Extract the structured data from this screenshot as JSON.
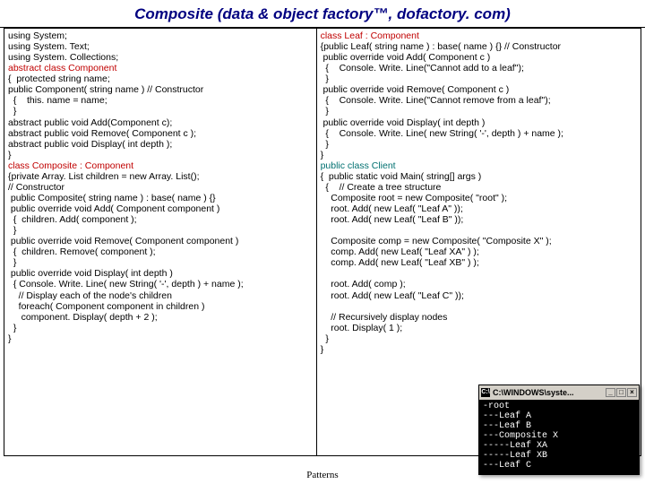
{
  "title": "Composite (data & object factory™, dofactory. com)",
  "left": {
    "l0": "using System;",
    "l1": "using System. Text;",
    "l2": "using System. Collections;",
    "l3": "abstract class Component",
    "l4": "{  protected string name;",
    "l5": "public Component( string name ) // Constructor",
    "l6": "  {    this. name = name;",
    "l7": "  }",
    "l8": "abstract public void Add(Component c);",
    "l9": "abstract public void Remove( Component c );",
    "l10": "abstract public void Display( int depth );",
    "l11": "}",
    "l12": "class Composite : Component",
    "l13": "{private Array. List children = new Array. List();",
    "l14": "// Constructor",
    "l15": " public Composite( string name ) : base( name ) {}",
    "l16": " public override void Add( Component component )",
    "l17": "  {  children. Add( component );",
    "l18": "  }",
    "l19": " public override void Remove( Component component )",
    "l20": "  {  children. Remove( component );",
    "l21": "  }",
    "l22": " public override void Display( int depth )",
    "l23": "  { Console. Write. Line( new String( '-', depth ) + name );",
    "l24": "    // Display each of the node's children",
    "l25": "    foreach( Component component in children )",
    "l26": "     component. Display( depth + 2 );",
    "l27": "  }",
    "l28": "}"
  },
  "right": {
    "r0": "class Leaf : Component",
    "r1": "{public Leaf( string name ) : base( name ) {} // Constructor",
    "r2": " public override void Add( Component c )",
    "r3": "  {    Console. Write. Line(\"Cannot add to a leaf\");",
    "r4": "  }",
    "r5": " public override void Remove( Component c )",
    "r6": "  {    Console. Write. Line(\"Cannot remove from a leaf\");",
    "r7": "  }",
    "r8": " public override void Display( int depth )",
    "r9": "  {    Console. Write. Line( new String( '-', depth ) + name );",
    "r10": "  }",
    "r11": "}",
    "r12": "public class Client",
    "r13": "{  public static void Main( string[] args )",
    "r14": "  {    // Create a tree structure",
    "r15": "    Composite root = new Composite( \"root\" );",
    "r16": "    root. Add( new Leaf( \"Leaf A\" ));",
    "r17": "    root. Add( new Leaf( \"Leaf B\" ));",
    "r18": " ",
    "r19": "    Composite comp = new Composite( \"Composite X\" );",
    "r20": "    comp. Add( new Leaf( \"Leaf XA\" ) );",
    "r21": "    comp. Add( new Leaf( \"Leaf XB\" ) );",
    "r22": " ",
    "r23": "    root. Add( comp );",
    "r24": "    root. Add( new Leaf( \"Leaf C\" ));",
    "r25": " ",
    "r26": "    // Recursively display nodes",
    "r27": "    root. Display( 1 );",
    "r28": "  }",
    "r29": "}"
  },
  "footer": "Patterns",
  "terminal": {
    "title": "C:\\WINDOWS\\syste...",
    "lines": [
      "-root",
      "---Leaf A",
      "---Leaf B",
      "---Composite X",
      "-----Leaf XA",
      "-----Leaf XB",
      "---Leaf C"
    ],
    "btn_min": "_",
    "btn_max": "□",
    "btn_close": "×"
  }
}
